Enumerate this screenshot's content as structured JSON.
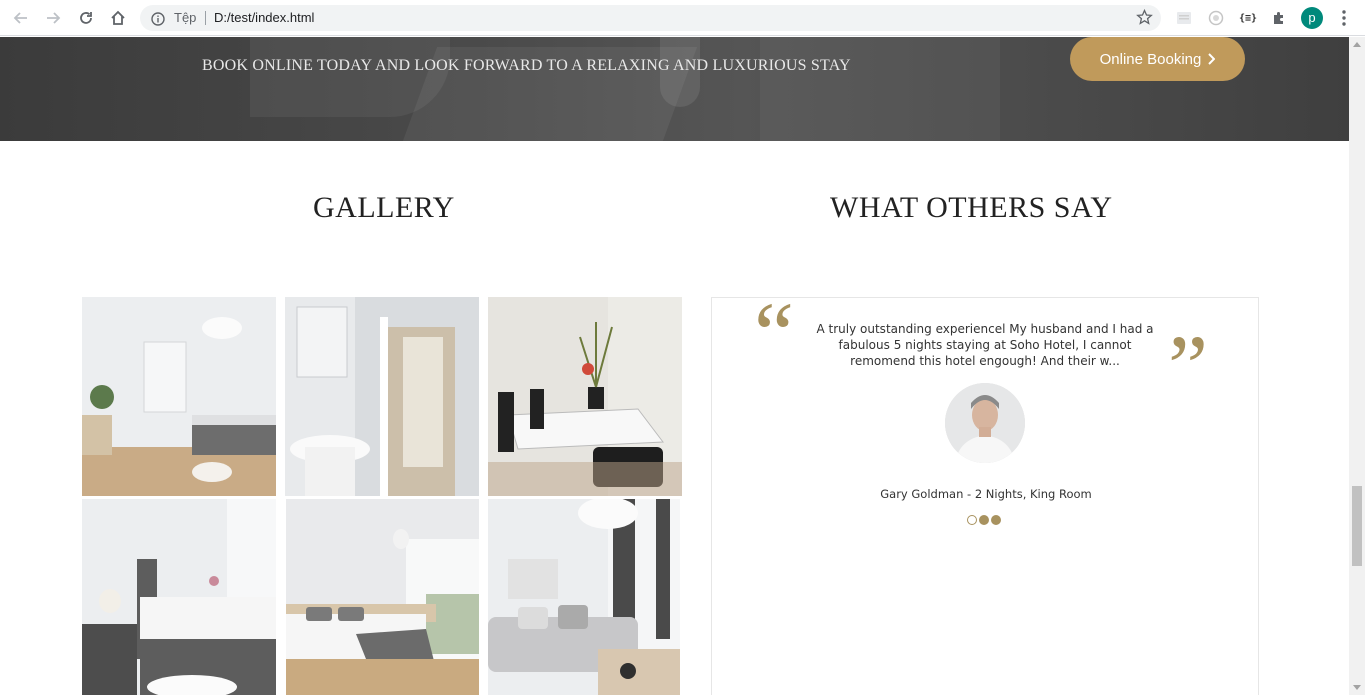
{
  "browser": {
    "scheme_label": "Tệp",
    "url": "D:/test/index.html",
    "profile_initial": "p",
    "icons": [
      "back-icon",
      "forward-icon",
      "reload-icon",
      "home-icon",
      "info-icon",
      "star-icon",
      "extension-puzzle-icon",
      "menu-icon"
    ]
  },
  "banner": {
    "text": "BOOK ONLINE TODAY AND LOOK FORWARD TO A RELAXING AND LUXURIOUS STAY",
    "button_label": "Online Booking"
  },
  "gallery": {
    "title": "GALLERY"
  },
  "testimonials": {
    "title": "WHAT OTHERS SAY",
    "quote": "A truly outstanding experiencel My husband and I had a fabulous 5 nights staying at Soho Hotel, I cannot remomend this hotel engough! And their w...",
    "author": "Gary Goldman - 2 Nights, King Room",
    "slides": 3,
    "active_slide": 1
  },
  "colors": {
    "accent": "#c09a5b",
    "quote_mark": "#a8925f",
    "banner_bg": "#4a4a4a"
  }
}
